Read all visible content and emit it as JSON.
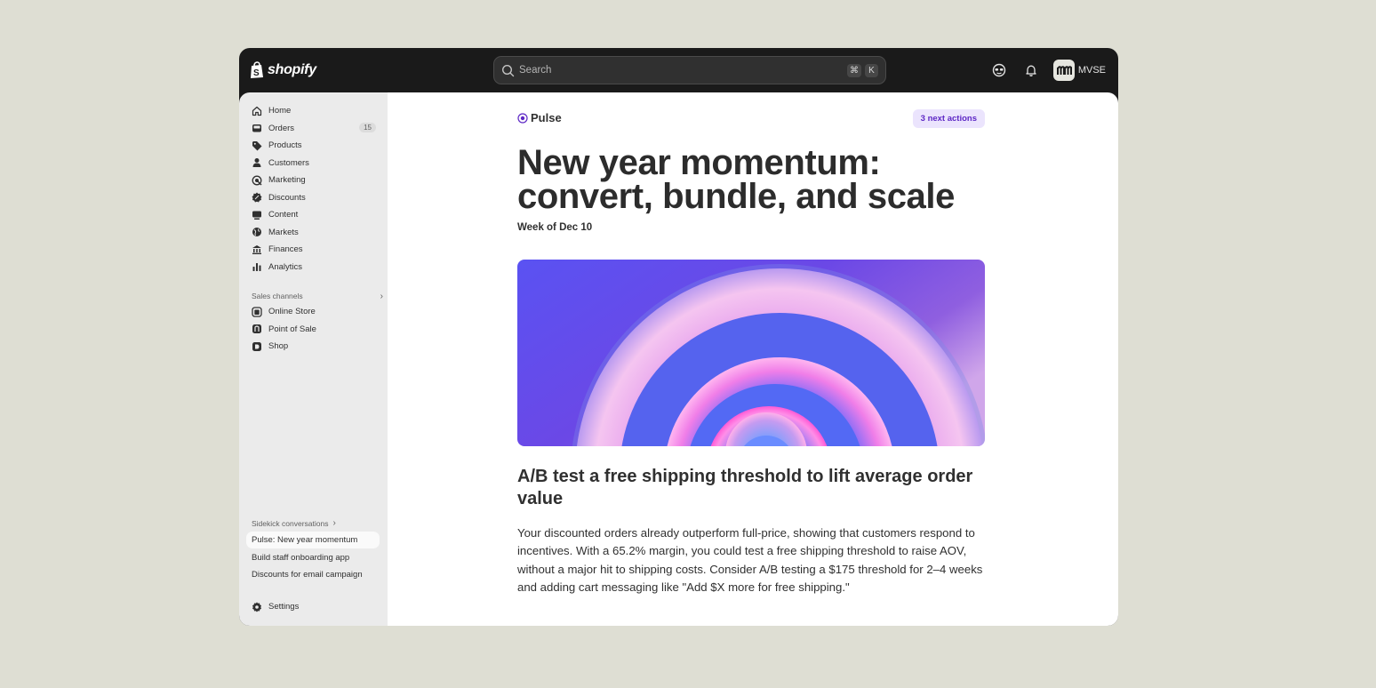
{
  "brand": {
    "name": "shopify"
  },
  "search": {
    "placeholder": "Search",
    "shortcut_mod": "⌘",
    "shortcut_key": "K"
  },
  "header": {
    "store_name": "MVSE"
  },
  "sidebar": {
    "items": [
      {
        "label": "Home",
        "icon": "home-icon"
      },
      {
        "label": "Orders",
        "icon": "inbox-icon",
        "count": "15"
      },
      {
        "label": "Products",
        "icon": "tag-icon"
      },
      {
        "label": "Customers",
        "icon": "person-icon"
      },
      {
        "label": "Marketing",
        "icon": "target-icon"
      },
      {
        "label": "Discounts",
        "icon": "discount-icon"
      },
      {
        "label": "Content",
        "icon": "content-icon"
      },
      {
        "label": "Markets",
        "icon": "globe-icon"
      },
      {
        "label": "Finances",
        "icon": "bank-icon"
      },
      {
        "label": "Analytics",
        "icon": "chart-icon"
      }
    ],
    "sales_channels_label": "Sales channels",
    "channels": [
      {
        "label": "Online Store",
        "icon": "store-icon"
      },
      {
        "label": "Point of Sale",
        "icon": "pos-icon"
      },
      {
        "label": "Shop",
        "icon": "shop-icon"
      }
    ],
    "sidekick_label": "Sidekick conversations",
    "conversations": [
      {
        "label": "Pulse: New year momentum",
        "active": true
      },
      {
        "label": "Build staff onboarding app",
        "active": false
      },
      {
        "label": "Discounts for email campaign",
        "active": false
      }
    ],
    "settings_label": "Settings"
  },
  "main": {
    "pulse_label": "Pulse",
    "actions_badge": "3 next actions",
    "headline_line1": "New year momentum:",
    "headline_line2": "convert, bundle, and scale",
    "week": "Week of Dec 10",
    "rec_title": "A/B test a free shipping threshold to lift average order value",
    "rec_body": "Your discounted orders already outperform full-price, showing that customers respond to incentives. With a 65.2% margin, you could test a free shipping threshold to raise AOV, without a major hit to shipping costs. Consider A/B testing a $175 threshold for 2–4 weeks and adding cart messaging like \"Add $X more for free shipping.\""
  },
  "colors": {
    "accent_purple": "#5d27c5",
    "badge_bg": "#ebe4fd",
    "topbar": "#1a1a1a",
    "sidebar_bg": "#ebebeb"
  }
}
